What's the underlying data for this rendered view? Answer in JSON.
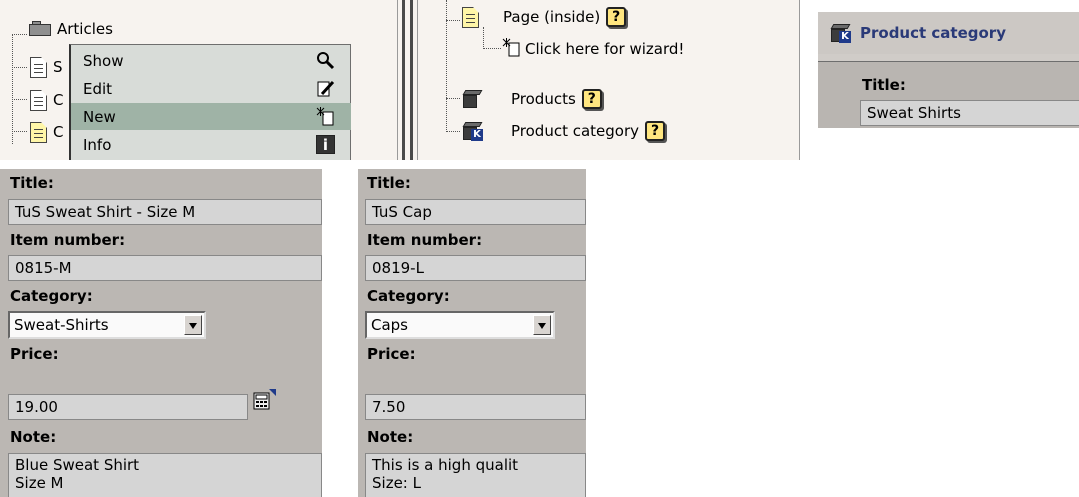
{
  "tree1": {
    "items": [
      {
        "label": "Articles"
      },
      {
        "label": "S"
      },
      {
        "label": "C"
      },
      {
        "label": "C"
      }
    ]
  },
  "context_menu": {
    "items": [
      {
        "label": "Show",
        "icon": "magnifier-icon"
      },
      {
        "label": "Edit",
        "icon": "edit-page-icon"
      },
      {
        "label": "New",
        "icon": "new-page-sparkle-icon",
        "highlighted": true
      },
      {
        "label": "Info",
        "icon": "info-icon"
      }
    ]
  },
  "tree2": {
    "items": [
      {
        "label": "Page (inside)",
        "help": "?"
      },
      {
        "label": "Click here for wizard!"
      },
      {
        "label": "Products",
        "help": "?"
      },
      {
        "label": "Product category",
        "help": "?"
      }
    ]
  },
  "category_panel": {
    "header": "Product category",
    "title_label": "Title:",
    "title_value": "Sweat Shirts"
  },
  "form_left": {
    "title_label": "Title:",
    "title_value": "TuS Sweat Shirt - Size M",
    "item_number_label": "Item number:",
    "item_number_value": "0815-M",
    "category_label": "Category:",
    "category_value": "Sweat-Shirts",
    "price_label": "Price:",
    "price_value": "19.00",
    "note_label": "Note:",
    "note_value": "Blue Sweat Shirt\nSize M"
  },
  "form_right": {
    "title_label": "Title:",
    "title_value": "TuS Cap",
    "item_number_label": "Item number:",
    "item_number_value": "0819-L",
    "category_label": "Category:",
    "category_value": "Caps",
    "price_label": "Price:",
    "price_value": "7.50",
    "note_label": "Note:",
    "note_value": "This is a high qualit\nSize: L"
  },
  "colors": {
    "panel_bg": "#f7f3ef",
    "form_bg": "#bbb7b3",
    "menu_highlight": "#9fb3a6",
    "category_header_text": "#2a3a78"
  }
}
